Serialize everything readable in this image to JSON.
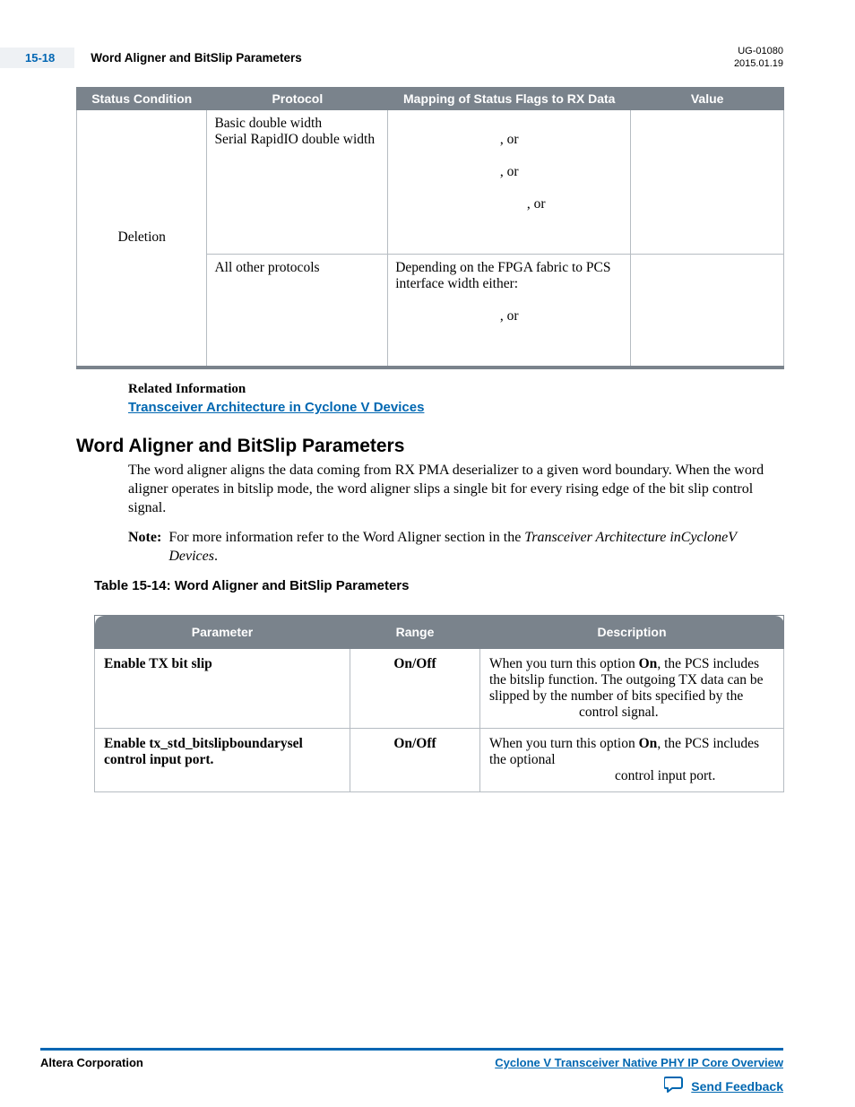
{
  "header": {
    "page_num": "15-18",
    "title": "Word Aligner and BitSlip Parameters",
    "doc_id": "UG-01080",
    "date": "2015.01.19"
  },
  "table1": {
    "headers": [
      "Status Condition",
      "Protocol",
      "Mapping of Status Flags to RX Data",
      "Value"
    ],
    "status_condition": "Deletion",
    "row1": {
      "protocol_line1": "Basic double width",
      "protocol_line2": "Serial RapidIO double width",
      "flags_sep": ", or"
    },
    "row2": {
      "protocol": "All other protocols",
      "flags_text": "Depending on the FPGA fabric to PCS interface width either:",
      "flags_sep": ", or"
    }
  },
  "related": {
    "heading": "Related Information",
    "link": "Transceiver Architecture in Cyclone V Devices"
  },
  "section": {
    "heading": "Word Aligner and BitSlip Parameters",
    "p1": "The word aligner aligns the data coming from RX PMA deserializer to a given word boundary. When the word aligner operates in bitslip mode, the word aligner slips a single bit for every rising edge of the bit slip control signal.",
    "note_label": "Note:",
    "note_text_prefix": "For more information refer to the Word Aligner section in the ",
    "note_text_ital": "Transceiver Architecture inCycloneV Devices",
    "note_text_suffix": "."
  },
  "table2": {
    "title": "Table 15-14: Word Aligner and BitSlip Parameters",
    "headers": [
      "Parameter",
      "Range",
      "Description"
    ],
    "rows": [
      {
        "param": "Enable TX bit slip",
        "range": "On/Off",
        "desc_prefix": "When you turn this option ",
        "desc_bold": "On",
        "desc_suffix": ", the PCS includes the bitslip function. The outgoing TX data can be slipped by the number of bits specified by the",
        "desc_tail": "control signal."
      },
      {
        "param": "Enable tx_std_bitslipboundarysel control input port.",
        "range": "On/Off",
        "desc_prefix": "When you turn this option ",
        "desc_bold": "On",
        "desc_suffix": ", the PCS includes the optional",
        "desc_tail": "control input port."
      }
    ]
  },
  "footer": {
    "left": "Altera Corporation",
    "right": "Cyclone V Transceiver Native PHY IP Core Overview",
    "feedback": "Send Feedback"
  }
}
